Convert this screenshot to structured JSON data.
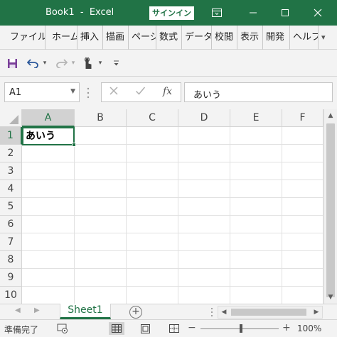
{
  "titlebar": {
    "title": "Book1  -  Excel",
    "signin_label": "サインイン",
    "bg_color": "#217346"
  },
  "ribbon_tabs": [
    "ファイル",
    "ホーム",
    "挿入",
    "描画",
    "ページ",
    "数式",
    "データ",
    "校閲",
    "表示",
    "開発",
    "ヘルプ"
  ],
  "qat": {
    "icons": [
      "save-icon",
      "undo-icon",
      "redo-icon",
      "touch-mode-icon",
      "customize-icon"
    ]
  },
  "formula_bar": {
    "name_box": "A1",
    "function_symbol": "fx",
    "content": "あいう"
  },
  "grid": {
    "columns": [
      "A",
      "B",
      "C",
      "D",
      "E",
      "F"
    ],
    "rows": [
      "1",
      "2",
      "3",
      "4",
      "5",
      "6",
      "7",
      "8",
      "9",
      "10"
    ],
    "selected_cell": "A1",
    "cell_A1": "あいう"
  },
  "sheets": {
    "tabs": [
      "Sheet1"
    ],
    "add_label": "+"
  },
  "status": {
    "ready": "準備完了",
    "zoom": "100%",
    "zoom_minus": "−",
    "zoom_plus": "+"
  }
}
